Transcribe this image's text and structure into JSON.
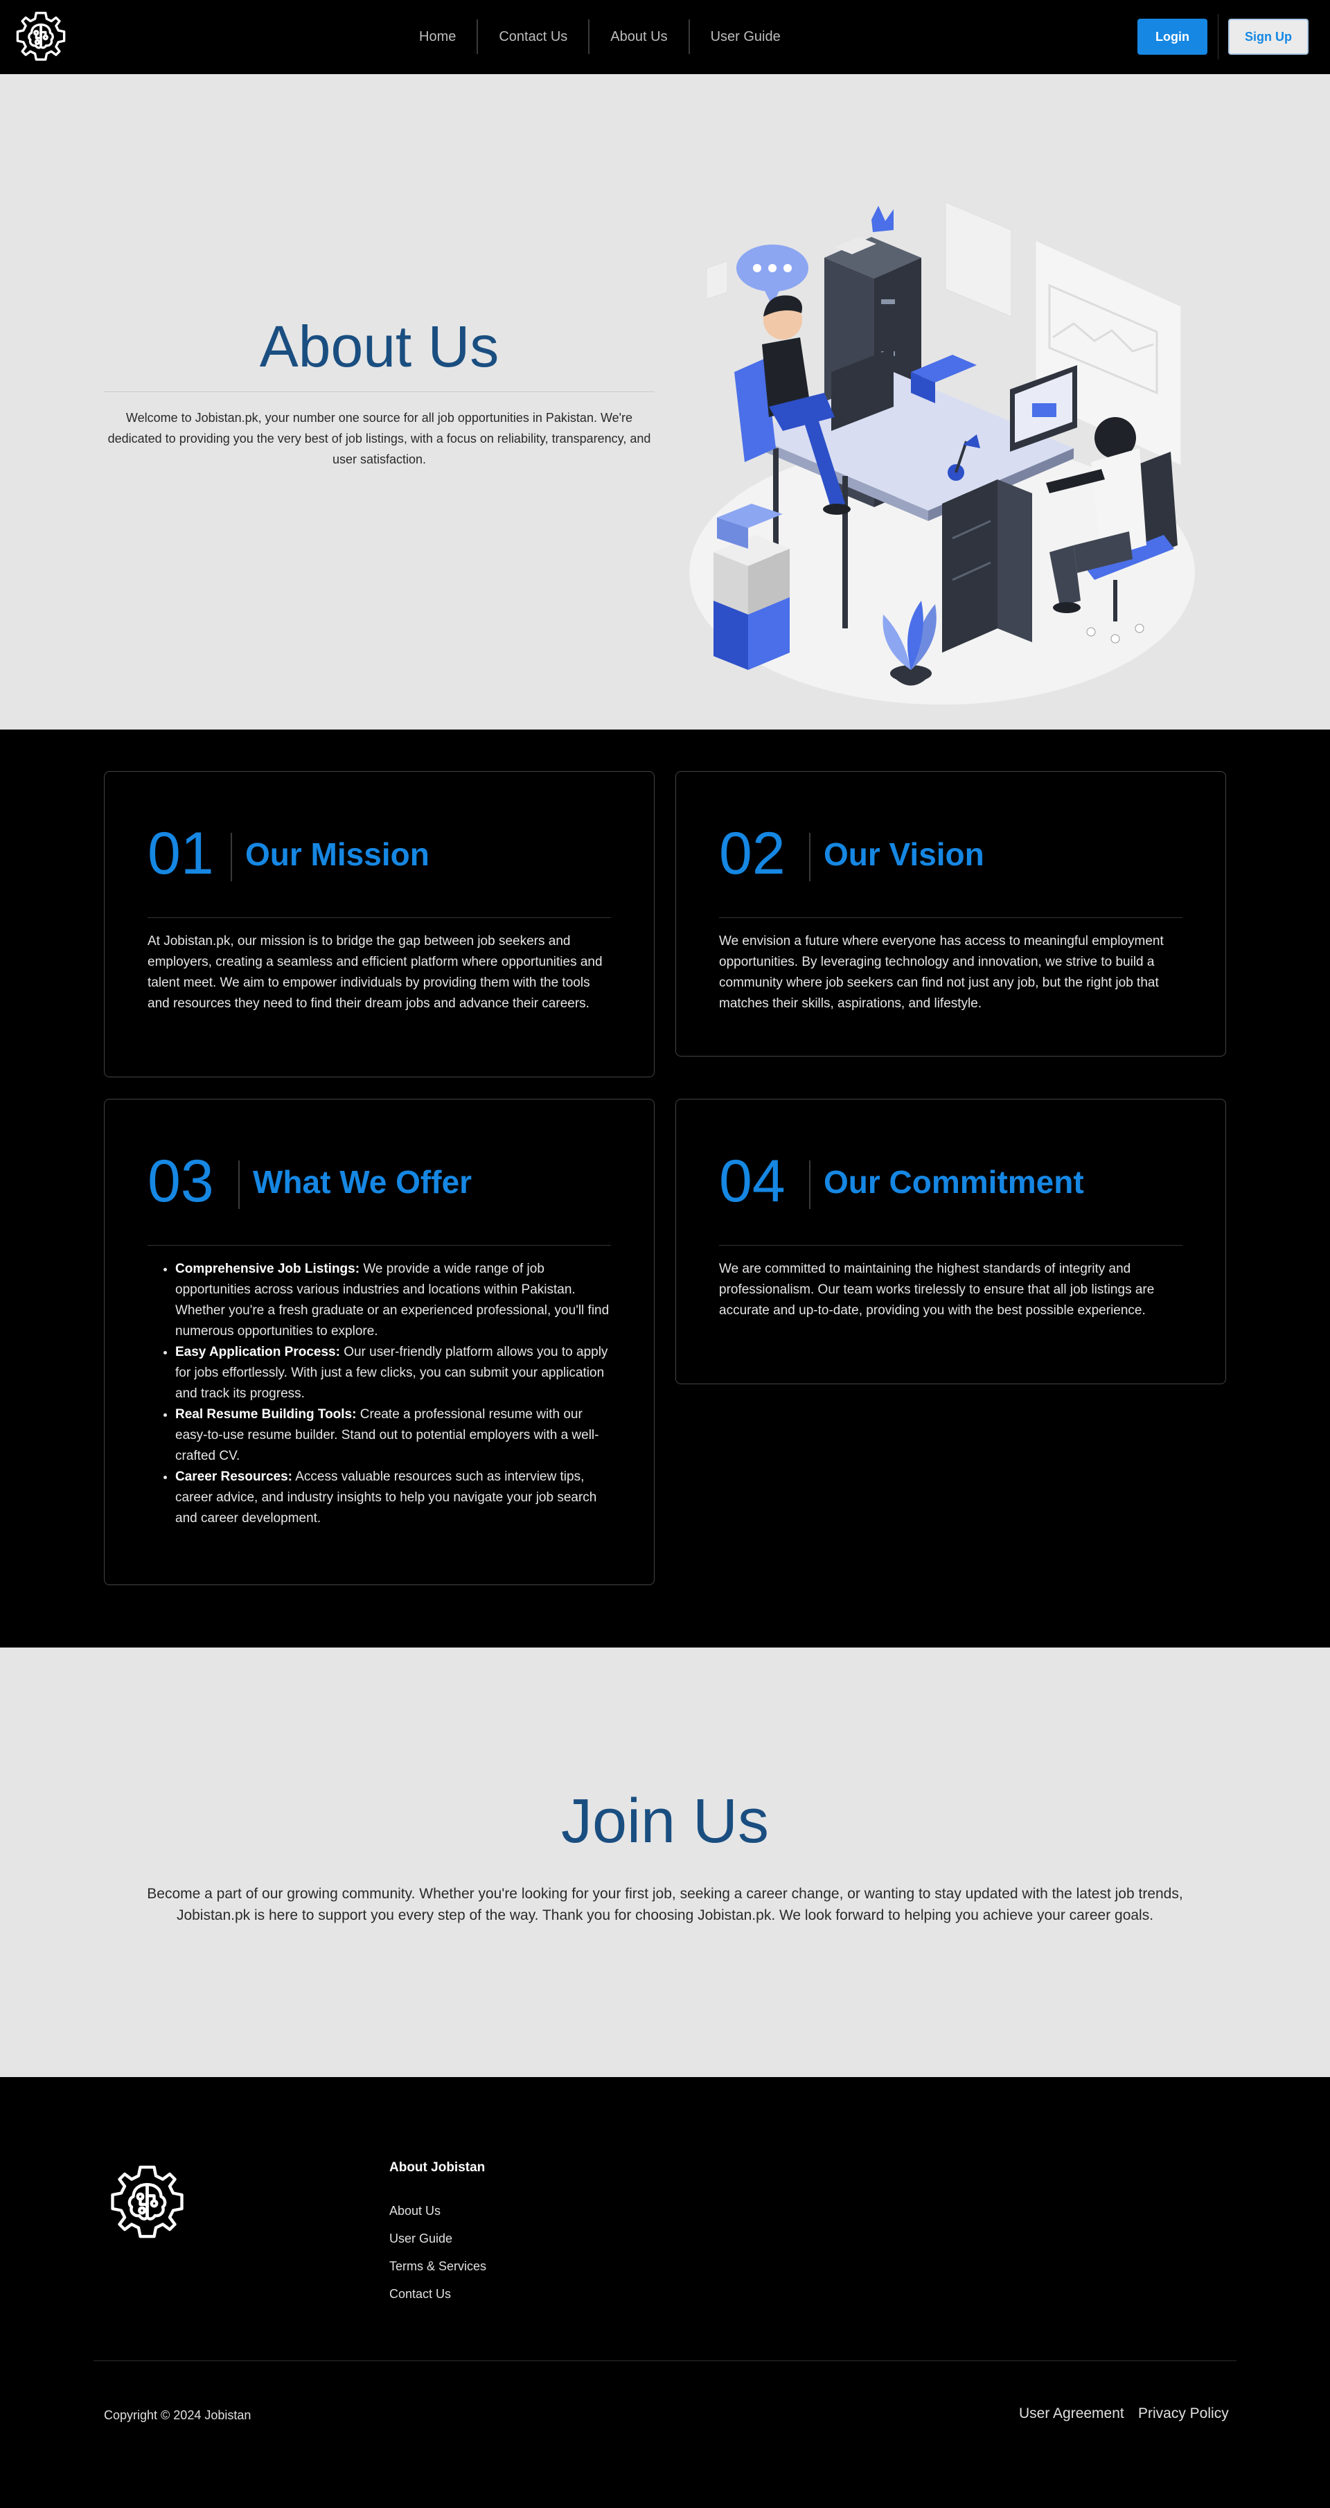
{
  "nav": {
    "links": [
      "Home",
      "Contact Us",
      "About Us",
      "User Guide"
    ],
    "login_label": "Login",
    "signup_label": "Sign Up"
  },
  "hero": {
    "title": "About Us",
    "description": "Welcome to Jobistan.pk, your number one source for all job opportunities in Pakistan. We're dedicated to providing you the very best of job listings, with a focus on reliability, transparency, and user satisfaction."
  },
  "cards": {
    "mission": {
      "number": "01",
      "title": "Our Mission",
      "body": "At Jobistan.pk, our mission is to bridge the gap between job seekers and employers, creating a seamless and efficient platform where opportunities and talent meet. We aim to empower individuals by providing them with the tools and resources they need to find their dream jobs and advance their careers."
    },
    "vision": {
      "number": "02",
      "title": "Our Vision",
      "body": "We envision a future where everyone has access to meaningful employment opportunities. By leveraging technology and innovation, we strive to build a community where job seekers can find not just any job, but the right job that matches their skills, aspirations, and lifestyle."
    },
    "offer": {
      "number": "03",
      "title": "What We Offer",
      "items": [
        {
          "label": "Comprehensive Job Listings:",
          "text": " We provide a wide range of job opportunities across various industries and locations within Pakistan. Whether you're a fresh graduate or an experienced professional, you'll find numerous opportunities to explore."
        },
        {
          "label": "Easy Application Process:",
          "text": " Our user-friendly platform allows you to apply for jobs effortlessly. With just a few clicks, you can submit your application and track its progress."
        },
        {
          "label": "Real Resume Building Tools:",
          "text": " Create a professional resume with our easy-to-use resume builder. Stand out to potential employers with a well-crafted CV."
        },
        {
          "label": "Career Resources:",
          "text": " Access valuable resources such as interview tips, career advice, and industry insights to help you navigate your job search and career development."
        }
      ]
    },
    "commitment": {
      "number": "04",
      "title": "Our Commitment",
      "body": "We are committed to maintaining the highest standards of integrity and professionalism. Our team works tirelessly to ensure that all job listings are accurate and up-to-date, providing you with the best possible experience."
    }
  },
  "join": {
    "title": "Join Us",
    "body": "Become a part of our growing community. Whether you're looking for your first job, seeking a career change, or wanting to stay updated with the latest job trends, Jobistan.pk is here to support you every step of the way. Thank you for choosing Jobistan.pk. We look forward to helping you achieve your career goals."
  },
  "footer": {
    "heading": "About Jobistan",
    "links": [
      "About Us",
      "User Guide",
      "Terms & Services",
      "Contact Us"
    ],
    "copyright": "Copyright © 2024 Jobistan",
    "legal": [
      "User Agreement",
      "Privacy Policy"
    ]
  },
  "colors": {
    "accent": "#1687e3",
    "heading_blue": "#1a4e80",
    "light_bg": "#e5e5e5",
    "dark_bg": "#000000"
  },
  "icons": [
    "brain-gear-logo-icon"
  ]
}
